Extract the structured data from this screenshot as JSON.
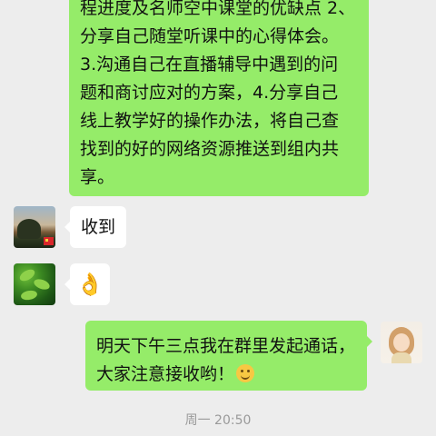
{
  "messages": [
    {
      "side": "self",
      "lines": [
        "程进度及名师空中课堂的优缺点 2、",
        "分享自己随堂听课中的心得体会。",
        "3.沟通自己在直播辅导中遇到的问",
        "题和商讨应对的方案，4.分享自己",
        "线上教学好的操作办法，将自己查",
        "找到的好的网络资源推送到组内共",
        "享。"
      ]
    },
    {
      "side": "other",
      "text": "收到",
      "avatar_icon": "sunset-landscape-avatar"
    },
    {
      "side": "other",
      "emoji": "ok-hand-icon",
      "avatar_icon": "green-leaves-avatar"
    },
    {
      "side": "self",
      "lines": [
        "明天下午三点我在群里发起通话，",
        "大家注意接收哟！"
      ],
      "emoji": "smile-icon",
      "avatar_icon": "girl-avatar"
    }
  ],
  "timestamp": "周一 20:50",
  "colors": {
    "background": "#ededed",
    "self_bubble": "#95ec69",
    "other_bubble": "#ffffff"
  }
}
